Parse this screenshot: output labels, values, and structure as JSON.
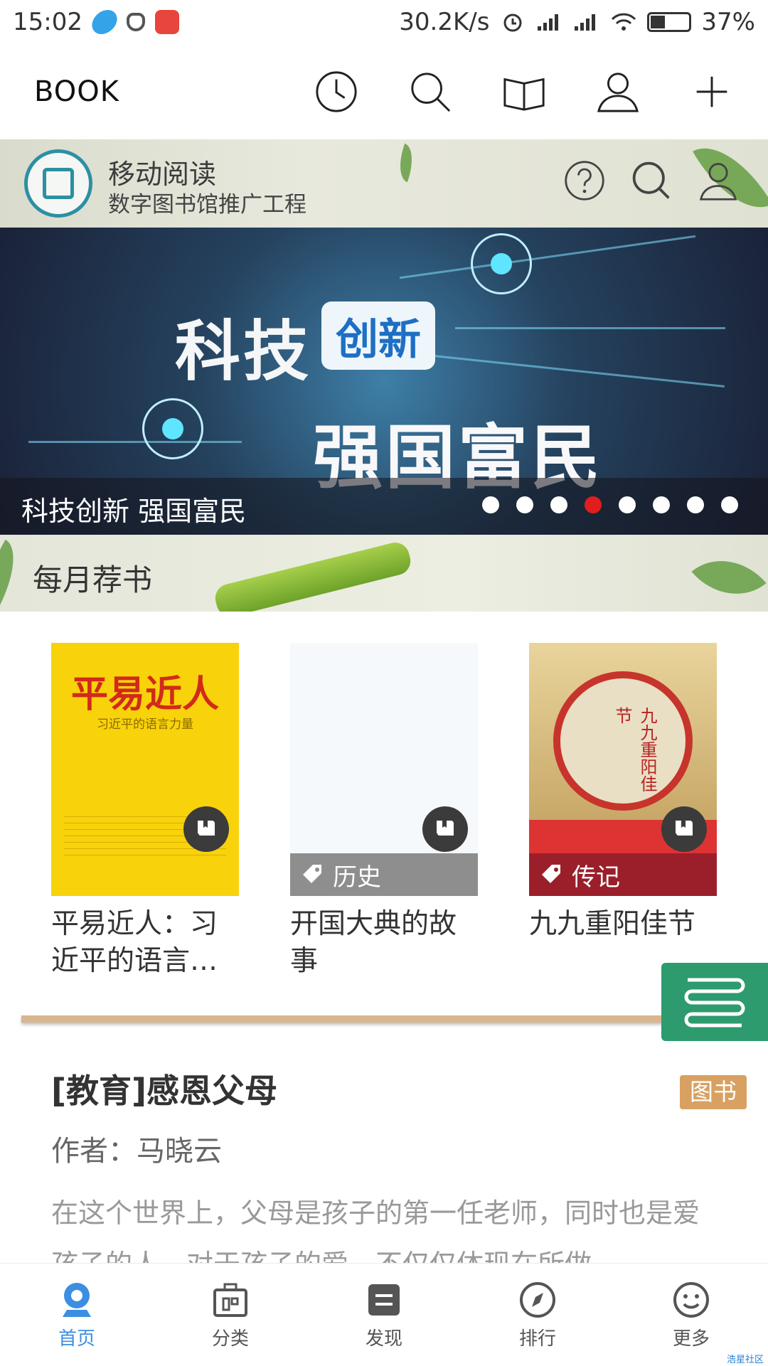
{
  "status": {
    "time": "15:02",
    "network_speed": "30.2K/s",
    "battery": "37%"
  },
  "app_bar": {
    "title": "BOOK"
  },
  "site_header": {
    "title": "移动阅读",
    "subtitle": "数字图书馆推广工程"
  },
  "carousel": {
    "headline_left": "科技",
    "headline_box": "创新",
    "headline_bottom": "强国富民",
    "caption": "科技创新 强国富民",
    "dot_count": 8,
    "active_dot": 4
  },
  "monthly": {
    "title": "每月荐书",
    "books": [
      {
        "title": "平易近人：习近平的语言…",
        "cover_title": "平易近人",
        "cover_subtitle": "习近平的语言力量",
        "tag": ""
      },
      {
        "title": "开国大典的故事",
        "tag": "历史"
      },
      {
        "title": "九九重阳佳节",
        "cover_title": "九九重阳佳节",
        "tag": "传记"
      }
    ]
  },
  "article": {
    "title": "[教育]感恩父母",
    "tag": "图书",
    "author": "作者：马晓云",
    "description": "在这个世界上，父母是孩子的第一任老师，同时也是爱孩子的人。对于孩子的爱，不仅仅体现在所做"
  },
  "tabs": [
    {
      "label": "首页",
      "icon": "home-icon",
      "active": true
    },
    {
      "label": "分类",
      "icon": "category-icon",
      "active": false
    },
    {
      "label": "发现",
      "icon": "discover-icon",
      "active": false
    },
    {
      "label": "排行",
      "icon": "compass-icon",
      "active": false
    },
    {
      "label": "更多",
      "icon": "smile-icon",
      "active": false
    }
  ],
  "watermark": "浩星社区",
  "colors": {
    "accent": "#3b8ee2",
    "fab": "#2d9b6e",
    "tag": "#d8a162",
    "active_dot": "#e01e1e"
  }
}
